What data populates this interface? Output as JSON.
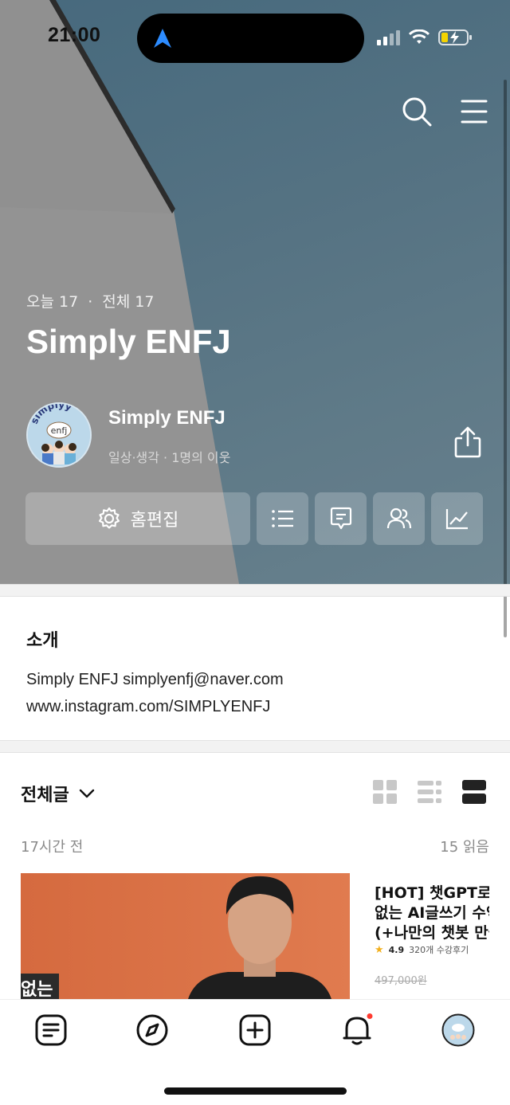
{
  "status": {
    "time": "21:00"
  },
  "cover": {
    "today_label": "오늘 17",
    "total_label": "전체 17",
    "separator": "·"
  },
  "blog": {
    "title": "Simply ENFJ",
    "owner_name": "Simply ENFJ",
    "owner_sub": "일상·생각 · 1명의 이웃",
    "avatar_text": "enfj",
    "avatar_arc_text": "simplyy"
  },
  "actions": {
    "edit_label": "홈편집"
  },
  "intro": {
    "heading": "소개",
    "line1": "Simply ENFJ simplyenfj@naver.com",
    "line2": "www.instagram.com/SIMPLYENFJ"
  },
  "posts": {
    "filter_label": "전체글",
    "items": [
      {
        "time": "17시간 전",
        "reads": "15 읽음",
        "thumb_badge": "없는",
        "ad_line1": "[HOT] 챗GPT로 ",
        "ad_line2": "없는 AI글쓰기 수익",
        "ad_line3": "(+나만의 챗봇 만들",
        "ad_rating": "4.9",
        "ad_reviews": "320개 수강후기",
        "ad_price": "497,000원"
      }
    ]
  },
  "colors": {
    "accent_red": "#ff3b30",
    "nav_blue": "#2d8cff",
    "battery_yellow": "#f5d400"
  },
  "icons": {
    "top": [
      "search-icon",
      "menu-icon"
    ],
    "tabs": [
      "feed-icon",
      "compass-icon",
      "add-post-icon",
      "bell-icon",
      "profile-avatar"
    ],
    "views": [
      "grid-view-icon",
      "list-view-icon",
      "card-view-icon"
    ]
  }
}
